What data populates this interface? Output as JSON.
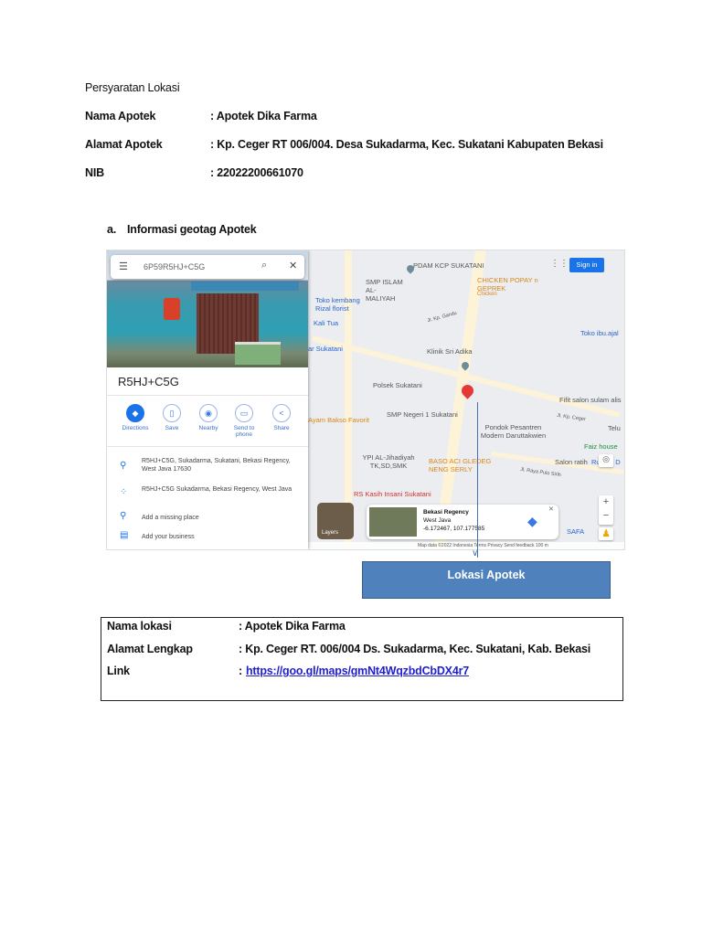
{
  "doc": {
    "title": "Persyaratan Lokasi",
    "fields": [
      {
        "label": "Nama Apotek",
        "value": ": Apotek Dika Farma"
      },
      {
        "label": "Alamat Apotek",
        "value": ": Kp. Ceger RT 006/004. Desa Sukadarma, Kec. Sukatani Kabupaten Bekasi"
      },
      {
        "label": "NIB",
        "value": ": 22022200661070"
      }
    ],
    "section_marker": "a.",
    "section_title": "Informasi geotag Apotek"
  },
  "maps_panel": {
    "search_value": "6P59R5HJ+C5G",
    "place_title": "R5HJ+C5G",
    "actions": [
      "Directions",
      "Save",
      "Nearby",
      "Send to phone",
      "Share"
    ],
    "address": "R5HJ+C5G, Sukadarma, Sukatani, Bekasi Regency, West Java 17630",
    "plus_code": "R5HJ+C5G Sukadarma, Bekasi Regency, West Java",
    "add_missing": "Add a missing place",
    "add_business": "Add your business"
  },
  "map": {
    "sign_in": "Sign in",
    "labels": [
      "PDAM KCP SUKATANI",
      "SMP ISLAM AL-MALIYAH",
      "CHICKEN POPAY n GEPREK",
      "Chicken",
      "Toko kembang Rizal florist",
      "Kali Tua",
      "ar Sukatani",
      "Toko ibu.ajal",
      "Klinik Sri Adika",
      "Polsek Sukatani",
      "SMP Negeri 1 Sukatani",
      "Fifit salon sulam alis",
      "Ayam Bakso Favorit",
      "Pondok Pesantren Modern Daruttakwien",
      "Telu",
      "Faiz house",
      "YPI AL-Jihadiyah TK,SD,SMK",
      "BASO ACI GLEDEG NENG SERLY",
      "Salon ratih",
      "Rumah D",
      "RS Kasih Insani Sukatani",
      "Jl. Kp. Gandu",
      "Jl. Kp. Ceger",
      "Jl. Raya Pulo Sirih",
      "SAFA"
    ],
    "layers": "Layers",
    "card_title": "Bekasi Regency",
    "card_sub": "West Java",
    "card_coords": "-6.172467, 107.177585",
    "footer": "Map data ©2022   Indonesia   Terms   Privacy   Send feedback   100 m"
  },
  "callout": "Lokasi Apotek",
  "table": {
    "rows": [
      {
        "label": "Nama lokasi",
        "value": ": Apotek Dika Farma"
      },
      {
        "label": "Alamat Lengkap",
        "value": ": Kp. Ceger RT. 006/004 Ds. Sukadarma, Kec. Sukatani, Kab. Bekasi"
      },
      {
        "label": "Link",
        "sep": ":",
        "link": "https://goo.gl/maps/gmNt4WqzbdCbDX4r7"
      }
    ]
  }
}
